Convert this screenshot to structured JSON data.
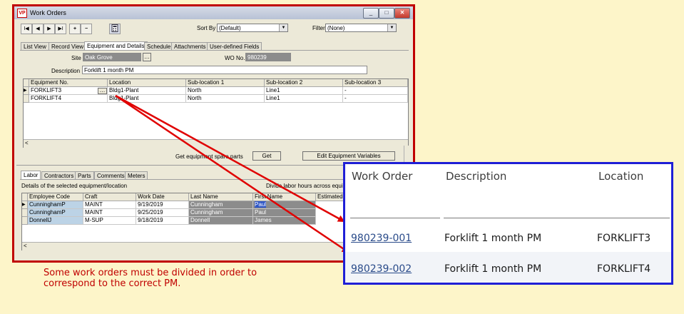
{
  "window": {
    "title": "Work Orders",
    "app_icon": "VP",
    "controls": [
      "_",
      "□",
      "✕"
    ]
  },
  "toolbar": {
    "nav_glyphs": [
      "I◀",
      "◀",
      "▶",
      "▶I",
      "+",
      "−"
    ],
    "sort_label": "Sort By",
    "sort_value": "(Default)",
    "filter_label": "Filter",
    "filter_value": "(None)"
  },
  "tabs": [
    "List View",
    "Record View",
    "Equipment and Details",
    "Schedule",
    "Attachments",
    "User-defined Fields"
  ],
  "form": {
    "site_label": "Site",
    "site_value": "Oak Grove",
    "wo_label": "WO No.",
    "wo_value": "980239",
    "desc_label": "Description",
    "desc_value": "Forklift 1 month PM"
  },
  "equipment_grid": {
    "columns": [
      "Equipment No.",
      "Location",
      "Sub-location 1",
      "Sub-location 2",
      "Sub-location 3"
    ],
    "rows": [
      [
        "FORKLIFT3",
        "Bldg1-Plant",
        "North",
        "Line1",
        "-"
      ],
      [
        "FORKLIFT4",
        "Bldg1-Plant",
        "North",
        "Line1",
        "-"
      ]
    ]
  },
  "actions": {
    "spare_parts_label": "Get equipment spare parts",
    "get_button": "Get",
    "edit_vars_button": "Edit Equipment Variables"
  },
  "lower_tabs": [
    "Labor",
    "Contractors",
    "Parts",
    "Comments",
    "Meters"
  ],
  "labor": {
    "details_label": "Details of the selected equipment/location",
    "divide_label": "Divide labor hours across equipm",
    "columns": [
      "Employee Code",
      "Craft",
      "Work Date",
      "Last Name",
      "First Name",
      "Estimated"
    ],
    "rows": [
      [
        "CunninghamP",
        "MAINT",
        "9/19/2019",
        "Cunningham",
        "Paul"
      ],
      [
        "CunninghamP",
        "MAINT",
        "9/25/2019",
        "Cunningham",
        "Paul"
      ],
      [
        "DonnellJ",
        "M-SUP",
        "9/18/2019",
        "Donnell",
        "James"
      ]
    ]
  },
  "result_panel": {
    "headers": [
      "Work Order",
      "Description",
      "Location"
    ],
    "rows": [
      [
        "980239-001",
        "Forklift 1 month PM",
        "FORKLIFT3"
      ],
      [
        "980239-002",
        "Forklift 1 month PM",
        "FORKLIFT4"
      ]
    ]
  },
  "caption": {
    "line1": "Some work orders must be divided in order to",
    "line2": "correspond to the correct PM."
  },
  "colors": {
    "background": "#fdf5c9",
    "window_border": "#c00000",
    "panel_border": "#1f1fd6",
    "arrow": "#e00000",
    "caption": "#c00000"
  }
}
